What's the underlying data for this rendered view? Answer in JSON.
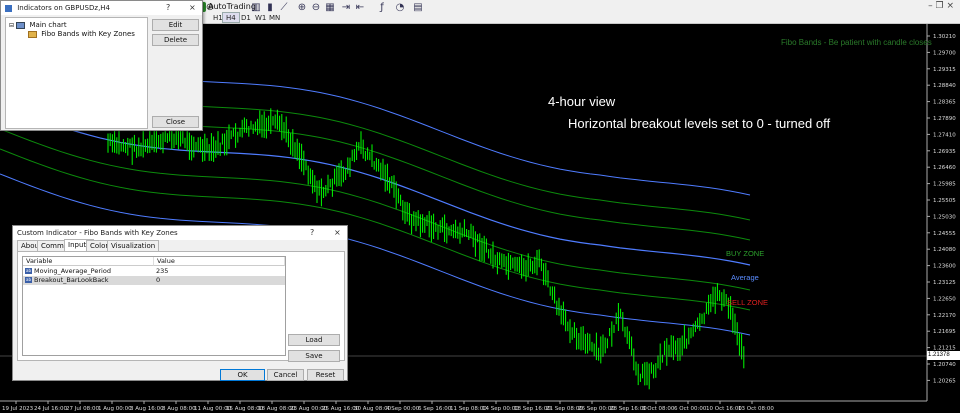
{
  "toolbar": {
    "timeframes": [
      "H1",
      "H4",
      "D1",
      "W1",
      "MN"
    ],
    "active_timeframe": "H4",
    "autotrading_label": "AutoTrading",
    "icons": [
      "zoom-in-icon",
      "zoom-out-icon",
      "grid-icon",
      "chart-bar-icon",
      "chart-candle-icon",
      "chart-line-icon",
      "indicators-icon",
      "period-icon",
      "templates-icon"
    ]
  },
  "chart": {
    "indicator_caption": "Fibo Bands - Be patient with candle closes",
    "annotation_line1": "4-hour view",
    "annotation_line2": "Horizontal breakout levels set to 0 - turned off",
    "zone_labels": {
      "buy": "BUY ZONE",
      "average": "Average",
      "sell": "SELL ZONE"
    },
    "current_price": "1.21378",
    "colors": {
      "candle": "#00ff00",
      "average": "#4f7cff",
      "bands": "#0c9a0c",
      "buy_label": "#2ca02c",
      "sell_label": "#e02020",
      "avg_label": "#5a8cff"
    },
    "price_axis": [
      "1.30210",
      "1.29700",
      "1.29315",
      "1.28840",
      "1.28365",
      "1.27890",
      "1.27410",
      "1.26935",
      "1.26460",
      "1.25985",
      "1.25505",
      "1.25030",
      "1.24555",
      "1.24080",
      "1.23600",
      "1.23125",
      "1.22650",
      "1.22170",
      "1.21695",
      "1.21215",
      "1.20740",
      "1.20265"
    ],
    "time_axis": [
      "19 Jul 2023",
      "24 Jul 16:00",
      "27 Jul 08:00",
      "1 Aug 00:00",
      "3 Aug 16:00",
      "8 Aug 08:00",
      "11 Aug 00:00",
      "15 Aug 08:00",
      "18 Aug 08:00",
      "23 Aug 00:00",
      "25 Aug 16:00",
      "30 Aug 08:00",
      "4 Sep 00:00",
      "6 Sep 16:00",
      "11 Sep 08:00",
      "14 Sep 00:00",
      "18 Sep 16:00",
      "21 Sep 08:00",
      "26 Sep 00:00",
      "28 Sep 16:00",
      "3 Oct 08:00",
      "6 Oct 00:00",
      "10 Oct 16:00",
      "13 Oct 08:00"
    ]
  },
  "indicators_dialog": {
    "title": "Indicators on GBPUSDz,H4",
    "title_help": "?",
    "title_close": "×",
    "tree_root": "Main chart",
    "tree_child": "Fibo Bands with Key Zones",
    "buttons": {
      "edit": "Edit",
      "delete": "Delete",
      "close": "Close"
    }
  },
  "custom_dialog": {
    "title": "Custom Indicator - Fibo Bands with Key Zones",
    "title_help": "?",
    "title_close": "×",
    "tabs": [
      "About",
      "Common",
      "Inputs",
      "Colors",
      "Visualization"
    ],
    "selected_tab": "Inputs",
    "columns": {
      "variable": "Variable",
      "value": "Value"
    },
    "params": [
      {
        "variable": "Moving_Average_Period",
        "value": "235"
      },
      {
        "variable": "Breakout_BarLookBack",
        "value": "0"
      }
    ],
    "param_icon": "ab",
    "buttons": {
      "load": "Load",
      "save": "Save",
      "ok": "OK",
      "cancel": "Cancel",
      "reset": "Reset"
    }
  }
}
